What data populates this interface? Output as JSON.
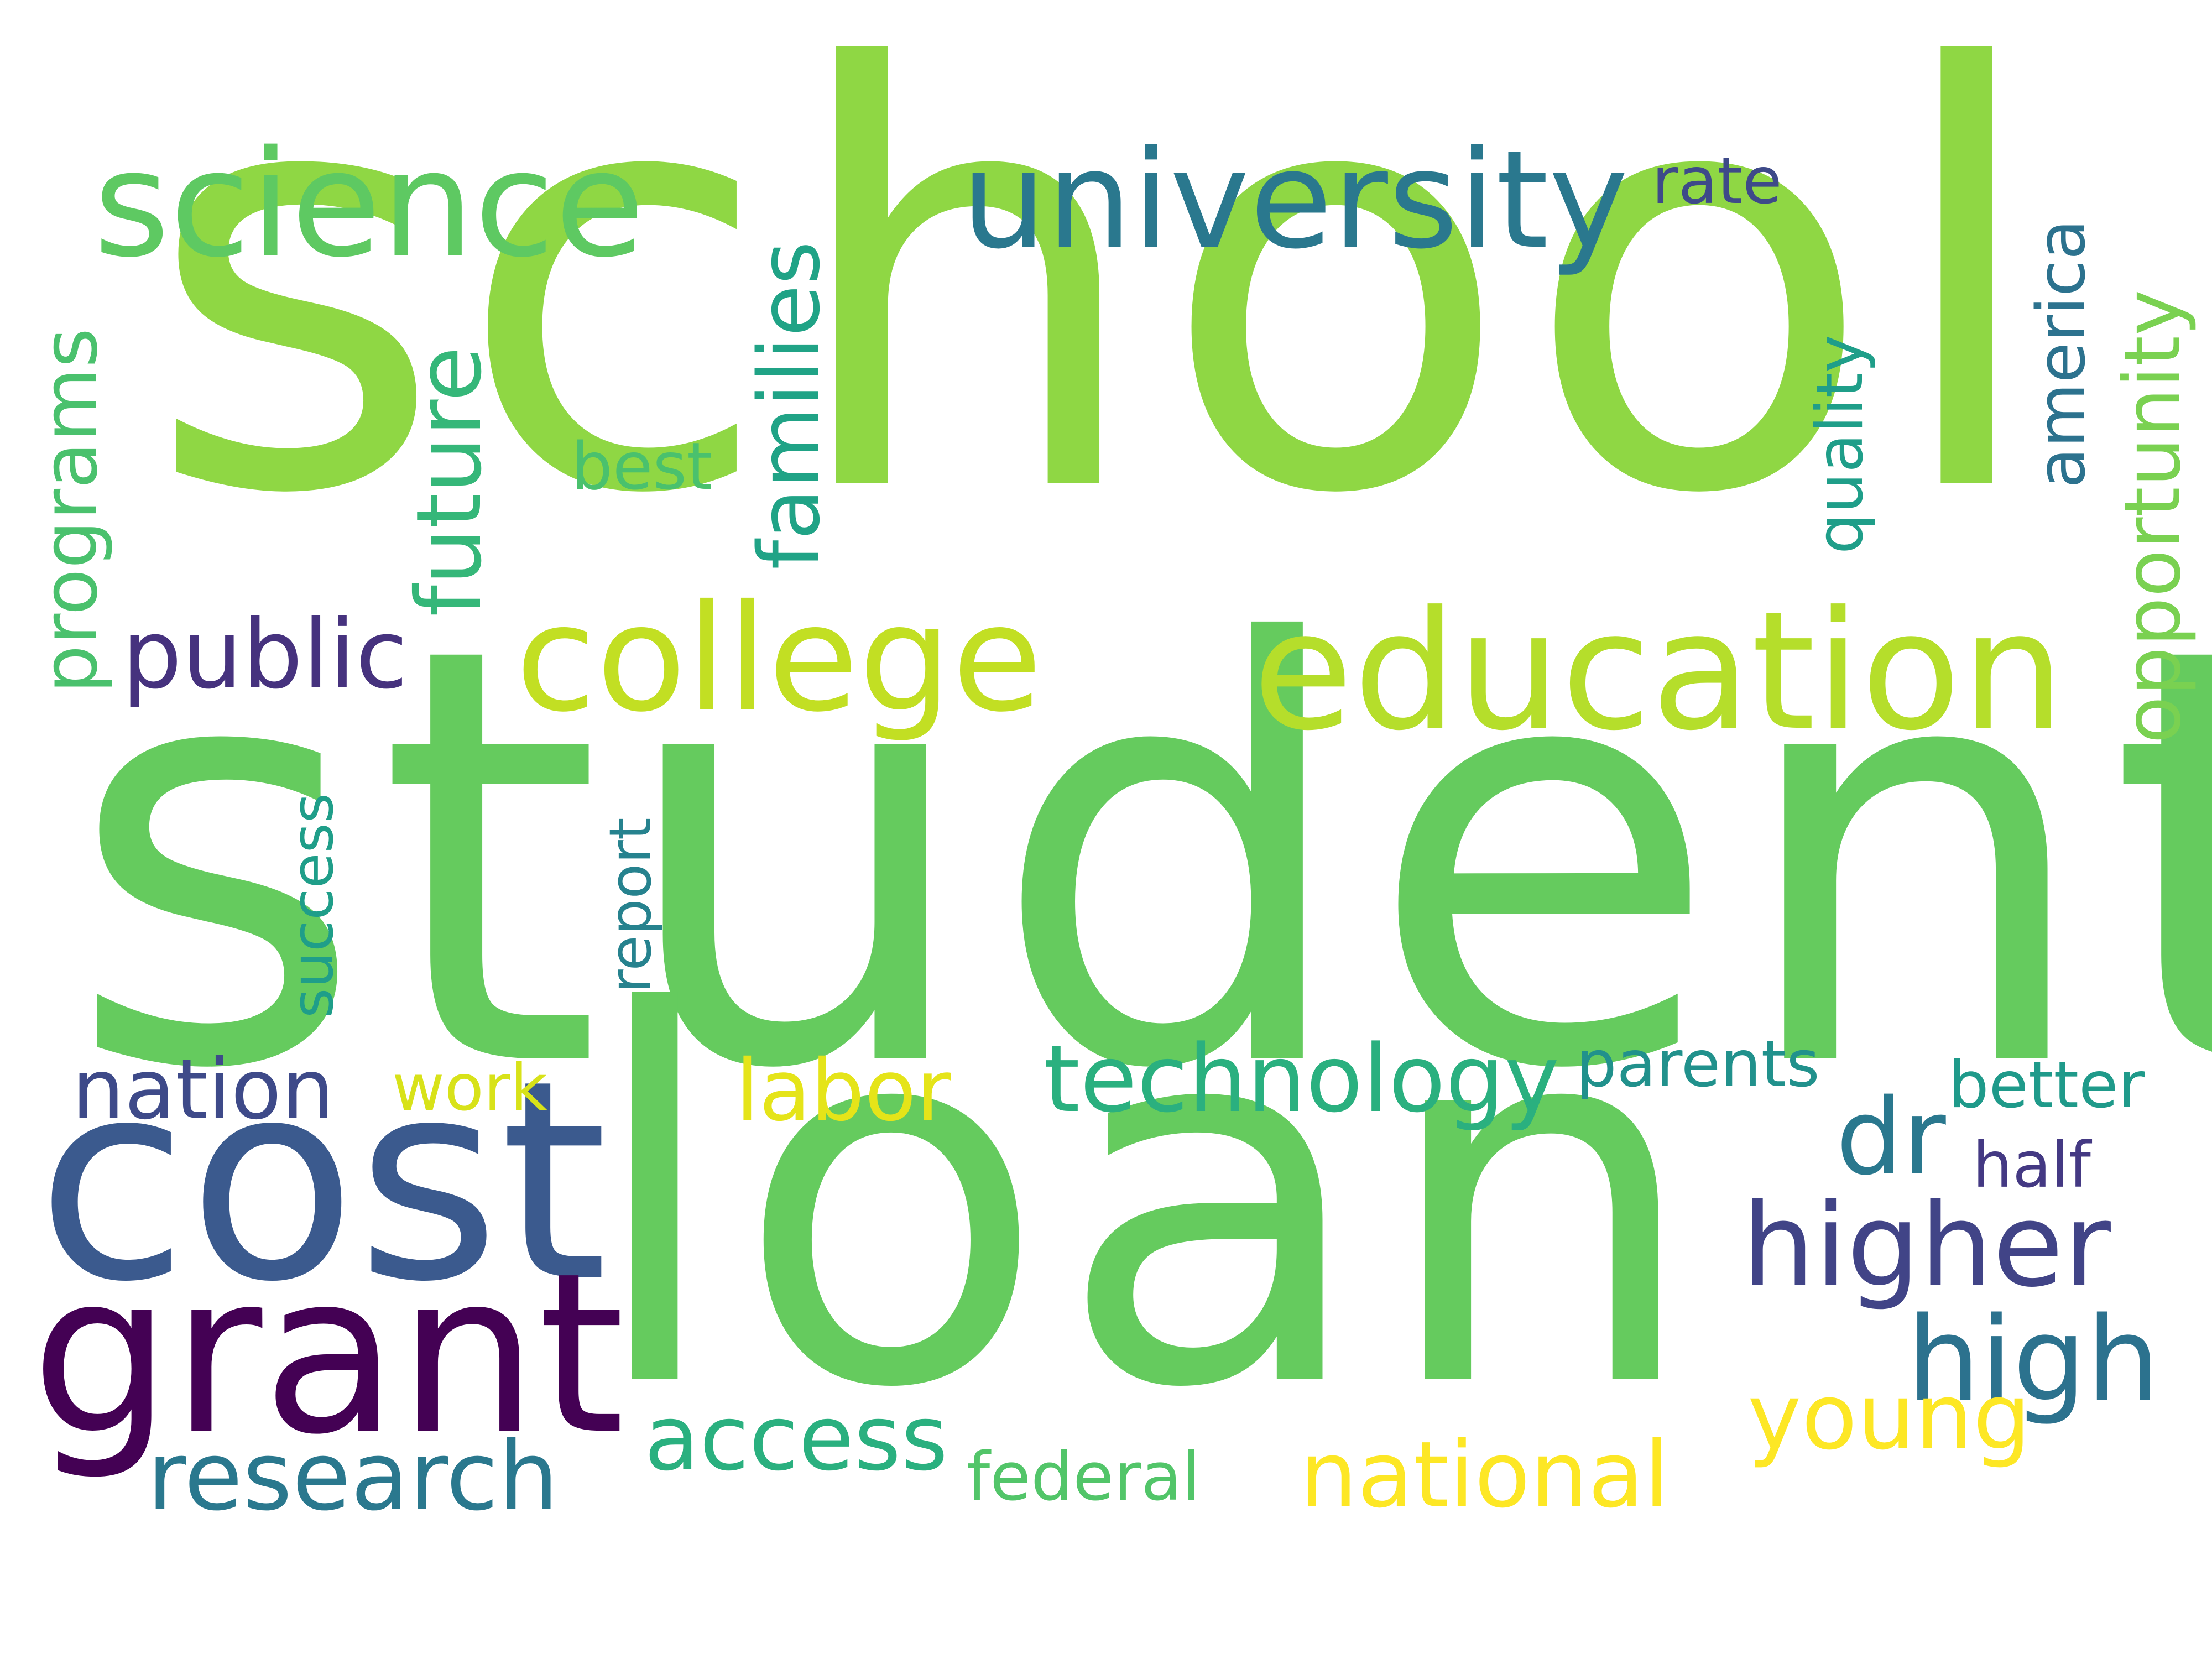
{
  "words": {
    "school": {
      "text": "school",
      "color": "#8fd744"
    },
    "student": {
      "text": "student",
      "color": "#65cb5e"
    },
    "loan": {
      "text": "loan",
      "color": "#65cb5e"
    },
    "cost": {
      "text": "cost",
      "color": "#3b5a8e"
    },
    "grant": {
      "text": "grant",
      "color": "#440154"
    },
    "science": {
      "text": "science",
      "color": "#5ec962"
    },
    "university": {
      "text": "university",
      "color": "#2a788e"
    },
    "college": {
      "text": "college",
      "color": "#c2df23"
    },
    "education": {
      "text": "education",
      "color": "#b5de2b"
    },
    "families": {
      "text": "families",
      "color": "#20a386"
    },
    "future": {
      "text": "future",
      "color": "#35b779"
    },
    "programs": {
      "text": "programs",
      "color": "#4ac16d"
    },
    "best": {
      "text": "best",
      "color": "#4ac16d"
    },
    "public": {
      "text": "public",
      "color": "#46327e"
    },
    "success": {
      "text": "success",
      "color": "#1f9e89"
    },
    "report": {
      "text": "report",
      "color": "#26828e"
    },
    "rate": {
      "text": "rate",
      "color": "#3e4a89"
    },
    "quality": {
      "text": "quality",
      "color": "#1f9e89"
    },
    "america": {
      "text": "america",
      "color": "#2c728e"
    },
    "opportunity": {
      "text": "opportunity",
      "color": "#7ad151"
    },
    "nation": {
      "text": "nation",
      "color": "#3e4a89"
    },
    "work": {
      "text": "work",
      "color": "#d8e219"
    },
    "labor": {
      "text": "labor",
      "color": "#e5e419"
    },
    "technology": {
      "text": "technology",
      "color": "#2ab07f"
    },
    "parents": {
      "text": "parents",
      "color": "#21918c"
    },
    "better": {
      "text": "better",
      "color": "#1f9a8a"
    },
    "dr": {
      "text": "dr",
      "color": "#2a788e"
    },
    "half": {
      "text": "half",
      "color": "#443983"
    },
    "higher": {
      "text": "higher",
      "color": "#414487"
    },
    "high": {
      "text": "high",
      "color": "#2c728e"
    },
    "young": {
      "text": "young",
      "color": "#fde725"
    },
    "national": {
      "text": "national",
      "color": "#fde725"
    },
    "federal": {
      "text": "federal",
      "color": "#52c569"
    },
    "access": {
      "text": "access",
      "color": "#2ab07f"
    },
    "research": {
      "text": "research",
      "color": "#2a788e"
    }
  }
}
